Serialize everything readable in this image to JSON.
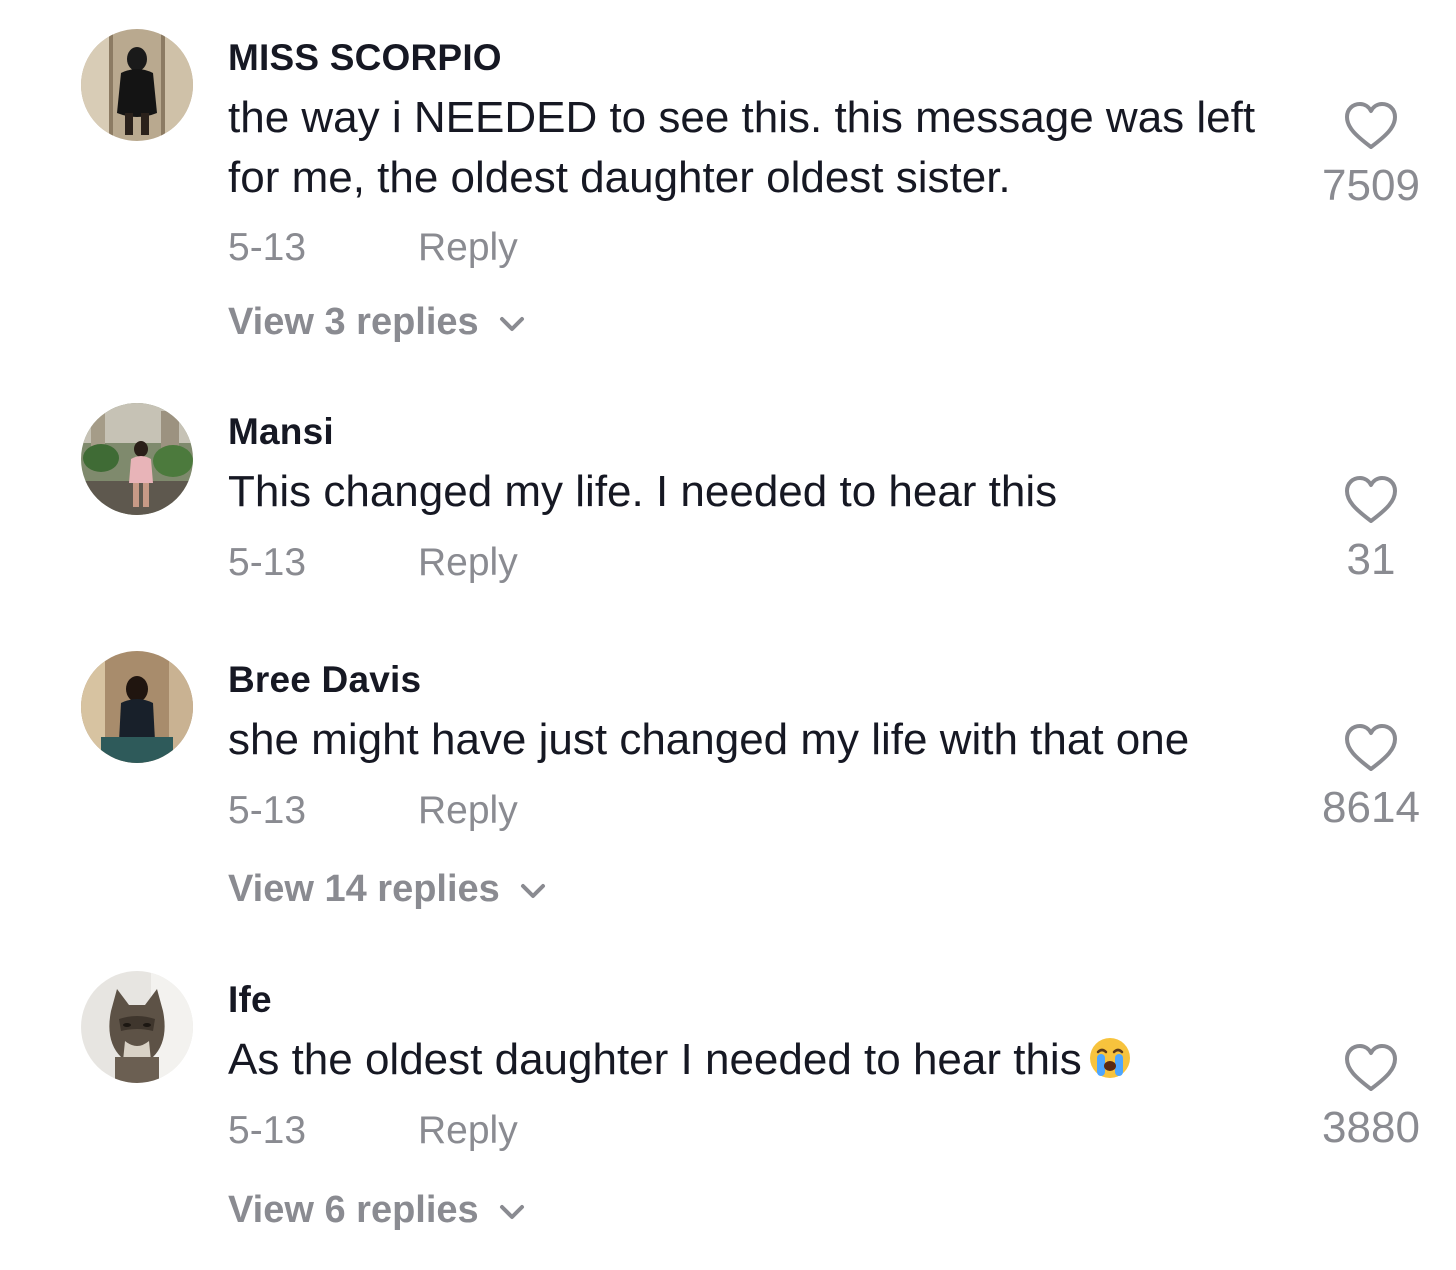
{
  "icons": {
    "like": "heart-outline-icon",
    "expand": "chevron-down-icon",
    "emoji": "loudly-crying-face-emoji"
  },
  "colors": {
    "text": "#161823",
    "secondary": "#8a8b91",
    "background": "#ffffff"
  },
  "comments": [
    {
      "username": "MISS SCORPIO",
      "text": "the way i NEEDED to see this. this message was left for me, the oldest daughter oldest sister.",
      "date": "5-13",
      "reply_label": "Reply",
      "likes": "7509",
      "view_replies": "View 3 replies"
    },
    {
      "username": "Mansi",
      "text": "This changed my life. I needed to hear this",
      "date": "5-13",
      "reply_label": "Reply",
      "likes": "31"
    },
    {
      "username": "Bree Davis",
      "text": "she might have just changed my life with that one",
      "date": "5-13",
      "reply_label": "Reply",
      "likes": "8614",
      "view_replies": "View 14 replies"
    },
    {
      "username": "Ife",
      "text": "As the oldest daughter I needed to hear this",
      "emoji": "😭",
      "date": "5-13",
      "reply_label": "Reply",
      "likes": "3880",
      "view_replies": "View 6 replies"
    }
  ]
}
